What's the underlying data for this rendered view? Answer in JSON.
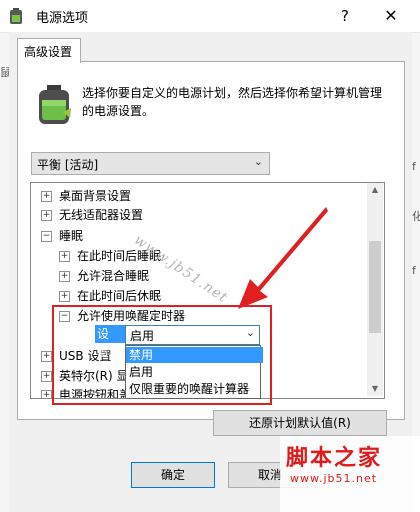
{
  "window": {
    "title": "电源选项",
    "help_glyph": "?",
    "close_glyph": "✕"
  },
  "background": {
    "right_fragments": [
      "f",
      "化",
      "f"
    ],
    "left_fragment": "鼠"
  },
  "tab": {
    "label": "高级设置"
  },
  "description": "选择你要自定义的电源计划，然后选择你希望计算机管理的电源设置。",
  "plan_select": {
    "value": "平衡 [活动]"
  },
  "tree": {
    "nodes": [
      {
        "expander": "+",
        "label": "桌面背景设置"
      },
      {
        "expander": "+",
        "label": "无线适配器设置"
      },
      {
        "expander": "−",
        "label": "睡眠"
      },
      {
        "expander": "+",
        "label": "在此时间后睡眠"
      },
      {
        "expander": "+",
        "label": "允许混合睡眠"
      },
      {
        "expander": "+",
        "label": "在此时间后休眠"
      },
      {
        "expander": "−",
        "label": "允许使用唤醒定时器"
      },
      {
        "expander": "+",
        "label": "USB 设置"
      },
      {
        "expander": "+",
        "label": "英特尔(R) 显"
      },
      {
        "expander": "+",
        "label": "电源按钮和盖"
      }
    ],
    "setting_label": "设置:",
    "setting_value": "启用"
  },
  "dropdown": {
    "options": [
      "禁用",
      "启用",
      "仅限重要的唤醒计算器"
    ],
    "selected": "禁用"
  },
  "buttons": {
    "restore": "还原计划默认值(R)",
    "ok": "确定",
    "cancel": "取消"
  },
  "watermarks": {
    "diagonal": "www.jb51.net",
    "brand": "脚本之家",
    "brand_url": "www.jb51.net"
  },
  "colors": {
    "highlight": "#e02020",
    "selection": "#3399ff",
    "watermark": "#e0191a"
  }
}
